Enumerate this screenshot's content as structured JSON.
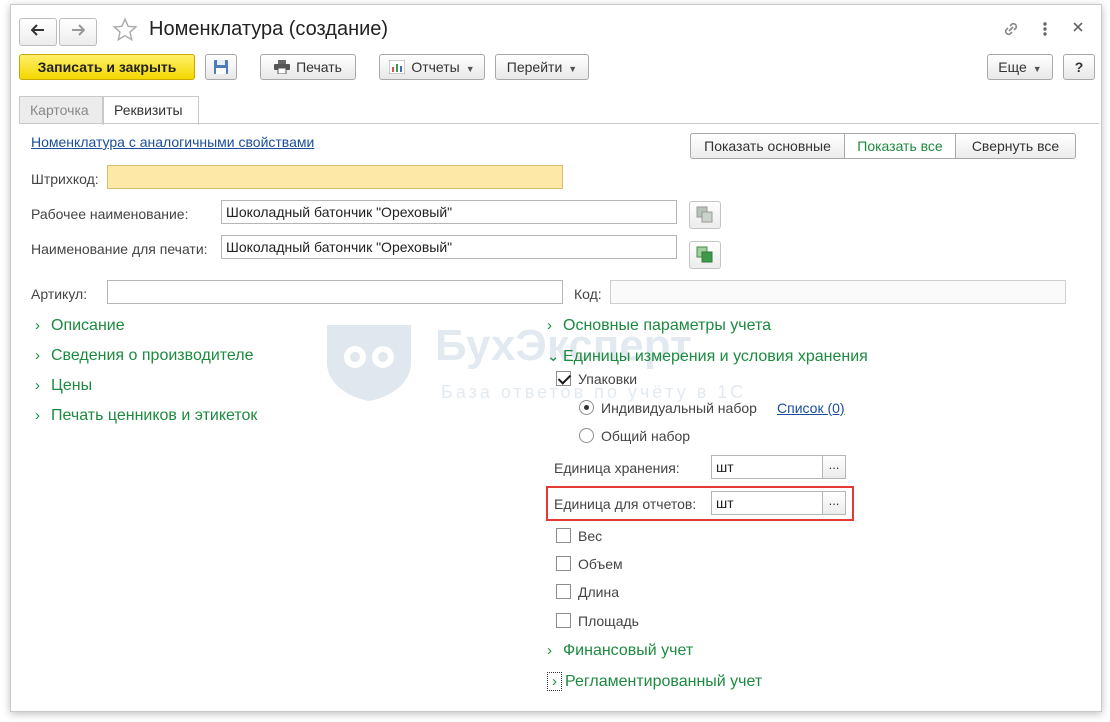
{
  "window": {
    "title": "Номенклатура (создание)",
    "header_icons": [
      "link-icon",
      "more-vertical-icon",
      "close-icon"
    ]
  },
  "toolbar": {
    "save_close": "Записать и закрыть",
    "print": "Печать",
    "reports": "Отчеты",
    "goto": "Перейти",
    "more": "Еще",
    "help": "?"
  },
  "tabs": [
    {
      "label": "Карточка",
      "active": false
    },
    {
      "label": "Реквизиты",
      "active": true
    }
  ],
  "links": {
    "similar": "Номенклатура с аналогичными свойствами"
  },
  "view_buttons": {
    "show_main": "Показать основные",
    "show_all": "Показать все",
    "collapse_all": "Свернуть все"
  },
  "fields": {
    "barcode": {
      "label": "Штрихкод:",
      "value": ""
    },
    "working_name": {
      "label": "Рабочее наименование:",
      "value": "Шоколадный батончик \"Ореховый\""
    },
    "print_name": {
      "label": "Наименование для печати:",
      "value": "Шоколадный батончик \"Ореховый\""
    },
    "article": {
      "label": "Артикул:",
      "value": ""
    },
    "code": {
      "label": "Код:",
      "value": ""
    }
  },
  "left_groups": [
    "Описание",
    "Сведения о производителе",
    "Цены",
    "Печать ценников и этикеток"
  ],
  "right_groups": {
    "accounting_params": "Основные параметры учета",
    "units_storage": "Единицы измерения и условия хранения",
    "financial": "Финансовый учет",
    "regulated": "Регламентированный учет"
  },
  "units": {
    "packages_label": "Упаковки",
    "packages_checked": true,
    "individual_set": "Индивидуальный набор",
    "list_link": "Список (0)",
    "common_set": "Общий набор",
    "selected_set": "individual",
    "storage_unit": {
      "label": "Единица хранения:",
      "value": "шт"
    },
    "report_unit": {
      "label": "Единица для отчетов:",
      "value": "шт"
    },
    "checkboxes": [
      {
        "label": "Вес",
        "checked": false
      },
      {
        "label": "Объем",
        "checked": false
      },
      {
        "label": "Длина",
        "checked": false
      },
      {
        "label": "Площадь",
        "checked": false
      }
    ],
    "select_button": "..."
  },
  "watermark": {
    "brand": "БухЭксперт",
    "tagline": "База ответов по учёту в 1С"
  },
  "colors": {
    "primary_button": "#f3d700",
    "group_green": "#1c8a3f",
    "link_blue": "#1a4e9c",
    "highlight_red": "#e53935",
    "barcode_field": "#fde8a8"
  }
}
